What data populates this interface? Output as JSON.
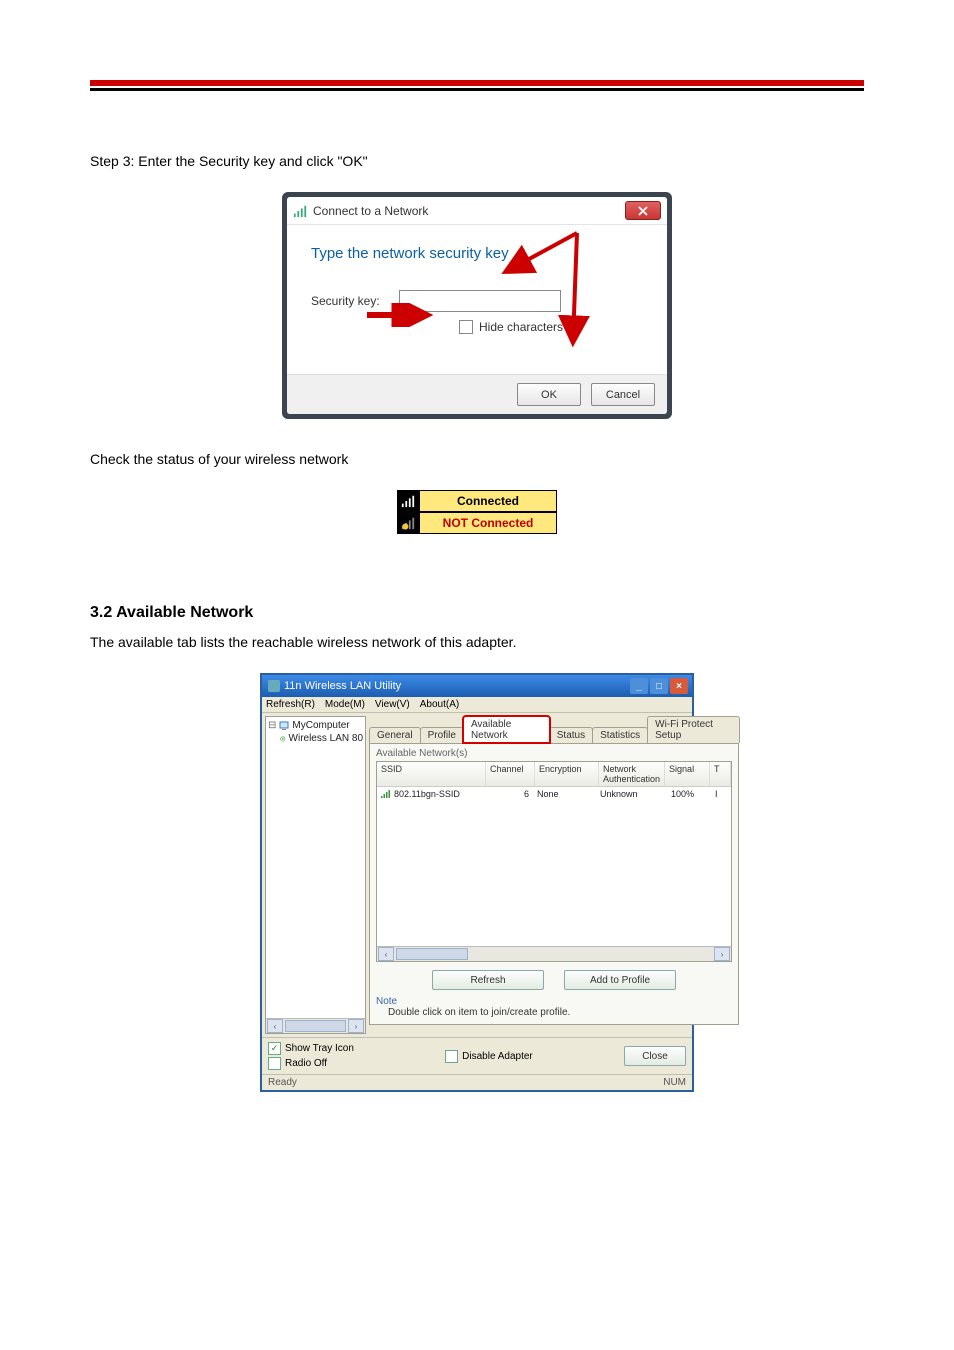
{
  "page": {
    "step3_instruction": "Step 3: Enter the Security key and click \"OK\"",
    "status_hint": "Check the status of your wireless network",
    "section_heading": "3.2 Available Network",
    "section_body": "The available tab lists the reachable wireless network of this adapter."
  },
  "dialog1": {
    "title": "Connect to a Network",
    "heading": "Type the network security key",
    "label": "Security key:",
    "input_value": "",
    "hide_label": "Hide characters",
    "ok": "OK",
    "cancel": "Cancel"
  },
  "status": {
    "connected": "Connected",
    "not_connected": "NOT Connected"
  },
  "util": {
    "title": "11n Wireless LAN Utility",
    "menu": {
      "refresh": "Refresh(R)",
      "mode": "Mode(M)",
      "view": "View(V)",
      "about": "About(A)"
    },
    "tree": {
      "root": "MyComputer",
      "adapter": "Wireless LAN 80"
    },
    "tabs": {
      "general": "General",
      "profile": "Profile",
      "available": "Available Network",
      "status": "Status",
      "statistics": "Statistics",
      "wps": "Wi-Fi Protect Setup"
    },
    "panel": {
      "subtitle": "Available Network(s)",
      "cols": {
        "ssid": "SSID",
        "channel": "Channel",
        "encryption": "Encryption",
        "auth": "Network Authentication",
        "signal": "Signal",
        "t": "T"
      },
      "row": {
        "ssid": "802.11bgn-SSID",
        "channel": "6",
        "encryption": "None",
        "auth": "Unknown",
        "signal": "100%",
        "t": "I"
      },
      "refresh_btn": "Refresh",
      "add_btn": "Add to Profile",
      "note_label": "Note",
      "note_text": "Double click on item to join/create profile."
    },
    "footer": {
      "show_tray": "Show Tray Icon",
      "radio_off": "Radio Off",
      "disable_adapter": "Disable Adapter",
      "close": "Close"
    },
    "statusbar": {
      "ready": "Ready",
      "num": "NUM"
    }
  }
}
